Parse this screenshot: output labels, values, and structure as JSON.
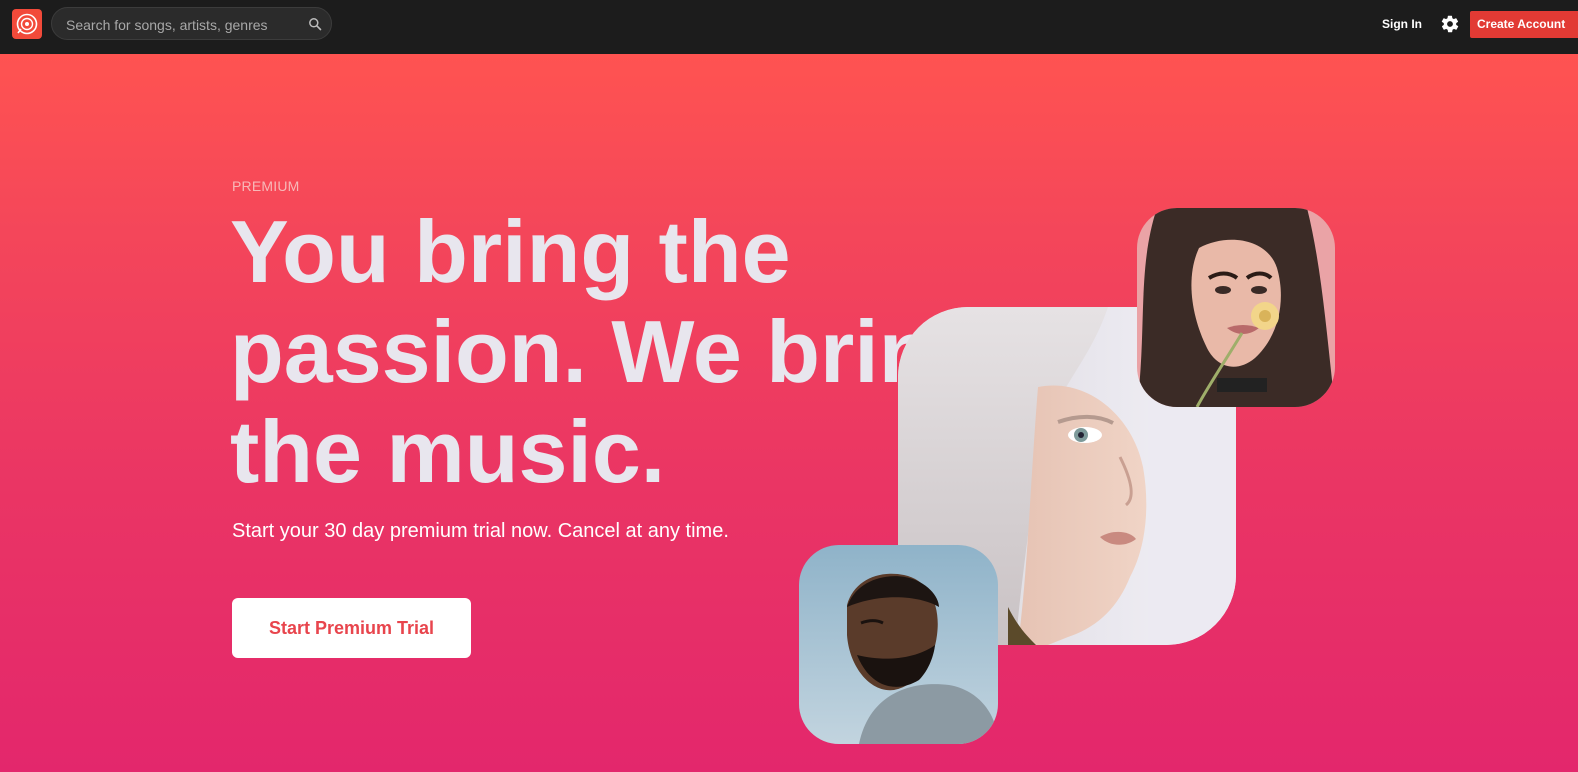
{
  "header": {
    "search_placeholder": "Search for songs, artists, genres",
    "sign_in_label": "Sign In",
    "create_account_label": "Create Account"
  },
  "hero": {
    "eyebrow": "PREMIUM",
    "headline_lines": [
      "You bring the",
      "passion. We bring",
      "the music."
    ],
    "subtitle": "Start your 30 day premium trial now. Cancel at any time.",
    "cta_label": "Start Premium Trial"
  },
  "colors": {
    "topbar": "#1c1c1c",
    "accent": "#e23a34",
    "hero_gradient_top": "#ff5351",
    "hero_gradient_bottom": "#e3276c",
    "headline": "#e8e6ee",
    "cta_text": "#e8454d"
  },
  "icons": {
    "logo": "vinyl-record-icon",
    "search": "search-icon",
    "settings": "gear-icon"
  }
}
